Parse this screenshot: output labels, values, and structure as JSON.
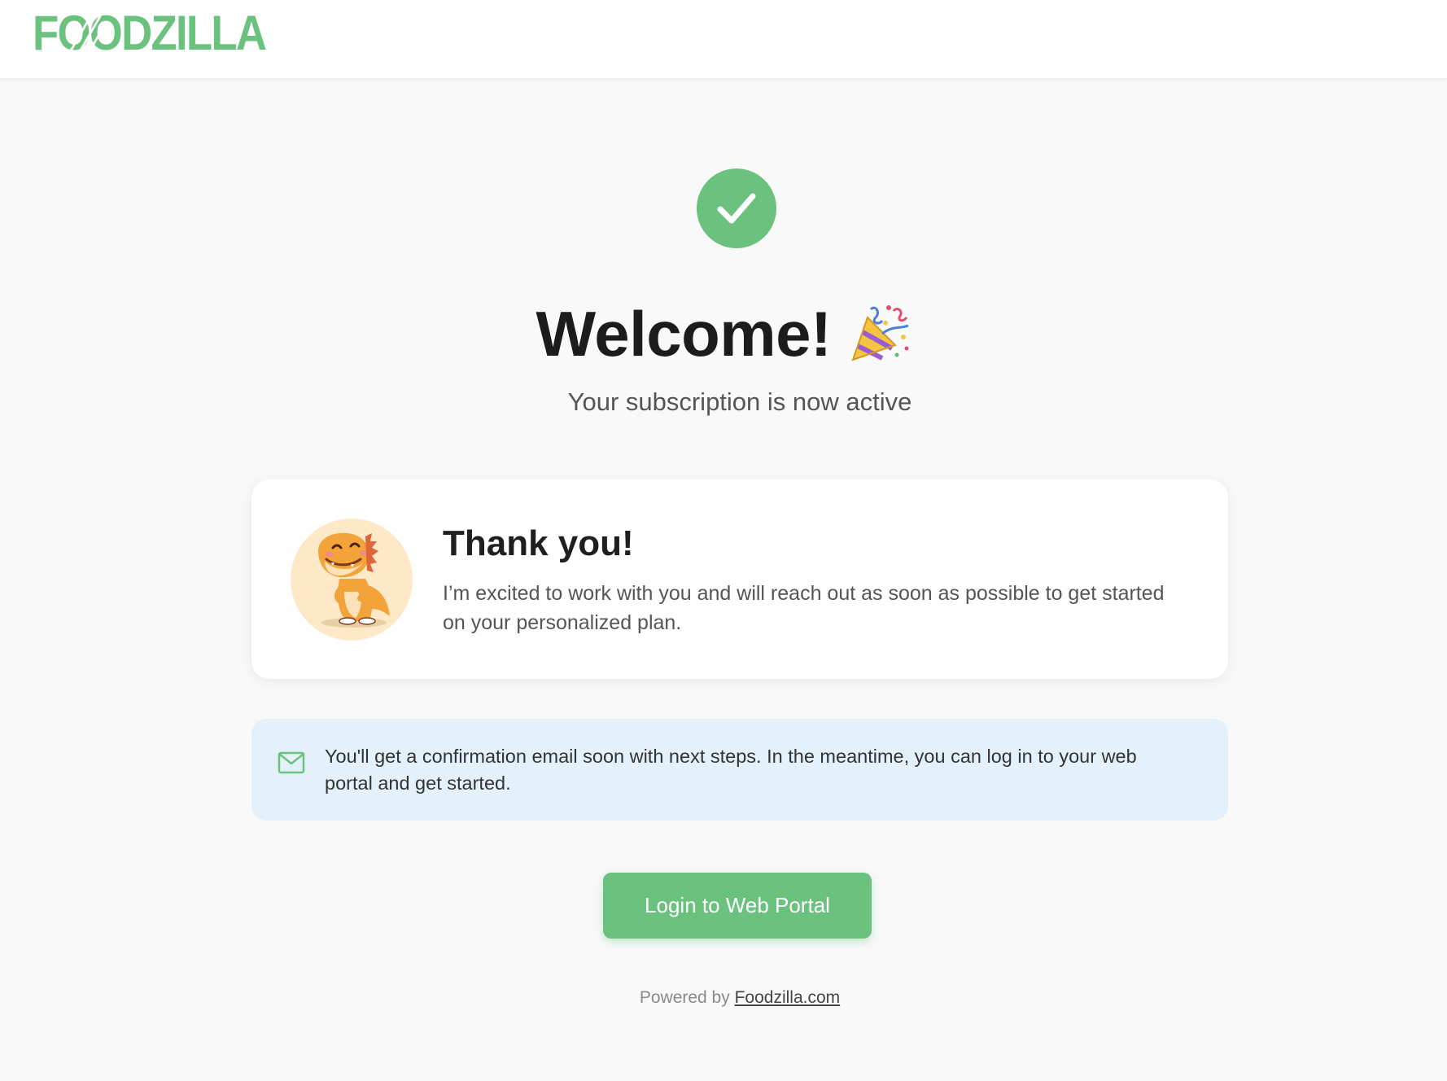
{
  "header": {
    "logo_text": "FOODZILLA",
    "logo_parts": [
      "F",
      "OO",
      "DZILLA"
    ]
  },
  "status": {
    "icon": "checkmark-icon",
    "color": "#6bc17e"
  },
  "hero": {
    "title": "Welcome!",
    "emoji": "party-popper-icon",
    "subtitle": "Your subscription is now active"
  },
  "card": {
    "avatar": "dinosaur-mascot",
    "title": "Thank you!",
    "text": "I’m excited to work with you and will reach out as soon as possible to get started on your personalized plan."
  },
  "info": {
    "icon": "mail-icon",
    "text": "You'll get a confirmation email soon with next steps. In the meantime, you can log in to your web portal and get started."
  },
  "actions": {
    "login_label": "Login to Web Portal"
  },
  "footer": {
    "prefix": "Powered by ",
    "link_text": "Foodzilla.com"
  },
  "colors": {
    "accent": "#6bc17e",
    "info_background": "#e4f0fa",
    "page_background": "#f9f9f9"
  }
}
